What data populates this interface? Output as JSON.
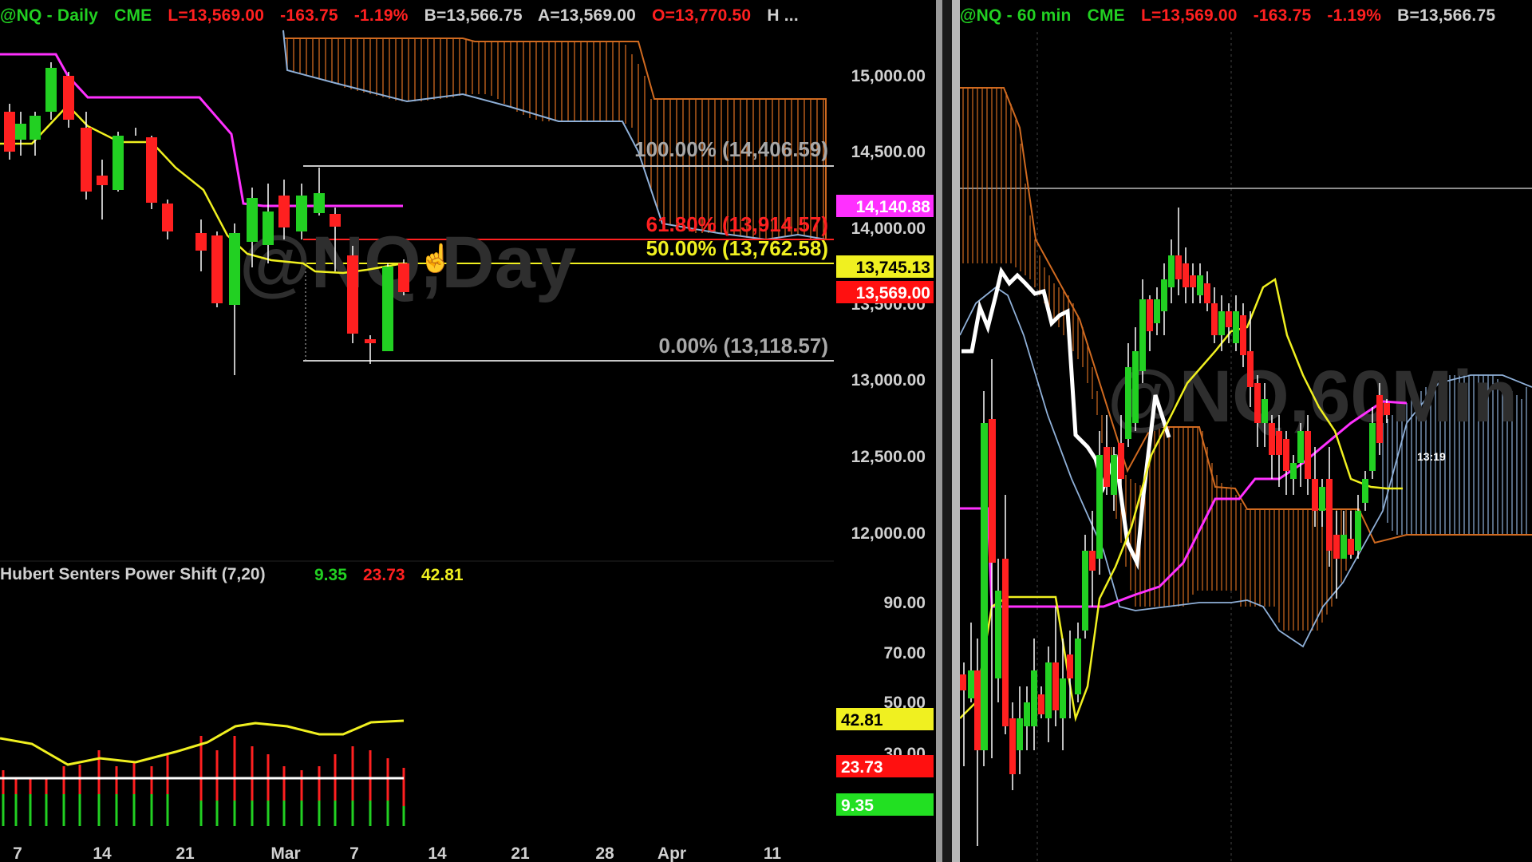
{
  "colors": {
    "background": "#000000",
    "up_candle": "#22d022",
    "down_candle": "#ff2020",
    "magenta": "#ff30ff",
    "yellow": "#f0f020",
    "cloud": "#d06a20",
    "cloud_blue": "#8fb0d8",
    "fib_gray": "#c0c0c0"
  },
  "daily_chart": {
    "header": {
      "symbol": "@NQ - Daily",
      "exchange": "CME",
      "last": "L=13,569.00",
      "change": "-163.75",
      "change_pct": "-1.19%",
      "bid": "B=13,566.75",
      "ask": "A=13,569.00",
      "open": "O=13,770.50",
      "more": "H ..."
    },
    "watermark": "@NQ,Day",
    "price_axis": [
      "15,000.00",
      "14,500.00",
      "14,000.00",
      "13,500.00",
      "13,000.00",
      "12,500.00",
      "12,000.00"
    ],
    "price_tags": {
      "magenta": "14,140.88",
      "yellow": "13,745.13",
      "red": "13,569.00"
    },
    "fib_levels": {
      "level_100": "100.00% (14,406.59)",
      "level_618": "61.80% (13,914.57)",
      "level_50": "50.00% (13,762.58)",
      "level_0": "0.00% (13,118.57)"
    },
    "date_axis": [
      "7",
      "14",
      "21",
      "Mar",
      "7",
      "14",
      "21",
      "28",
      "Apr",
      "11"
    ]
  },
  "indicator": {
    "title": "Hubert Senters Power Shift (7,20)",
    "value_green": "9.35",
    "value_red": "23.73",
    "value_yellow": "42.81",
    "axis": [
      "90.00",
      "70.00",
      "50.00",
      "30.00"
    ],
    "tags": {
      "yellow": "42.81",
      "red": "23.73",
      "green": "9.35"
    }
  },
  "hourly_chart": {
    "header": {
      "symbol": "@NQ - 60 min",
      "exchange": "CME",
      "last": "L=13,569.00",
      "change": "-163.75",
      "change_pct": "-1.19%",
      "bid": "B=13,566.75"
    },
    "watermark": "@NQ,60Min",
    "time_label": "13:19"
  },
  "chart_data": {
    "type": "candlestick",
    "title": "@NQ - Daily",
    "ylabel": "",
    "ylim": [
      11700,
      15300
    ],
    "approx_closes": [
      14650,
      14400,
      14100,
      14450,
      14150,
      13900,
      13700,
      13300,
      13600,
      13800,
      13900,
      13700,
      13300,
      13200,
      13569
    ],
    "fibonacci": [
      {
        "label": "100.00%",
        "value": 14406.59
      },
      {
        "label": "61.80%",
        "value": 13914.57
      },
      {
        "label": "50.00%",
        "value": 13762.58
      },
      {
        "label": "0.00%",
        "value": 13118.57
      }
    ],
    "indicator_values": {
      "green": 9.35,
      "red": 23.73,
      "yellow": 42.81
    }
  }
}
